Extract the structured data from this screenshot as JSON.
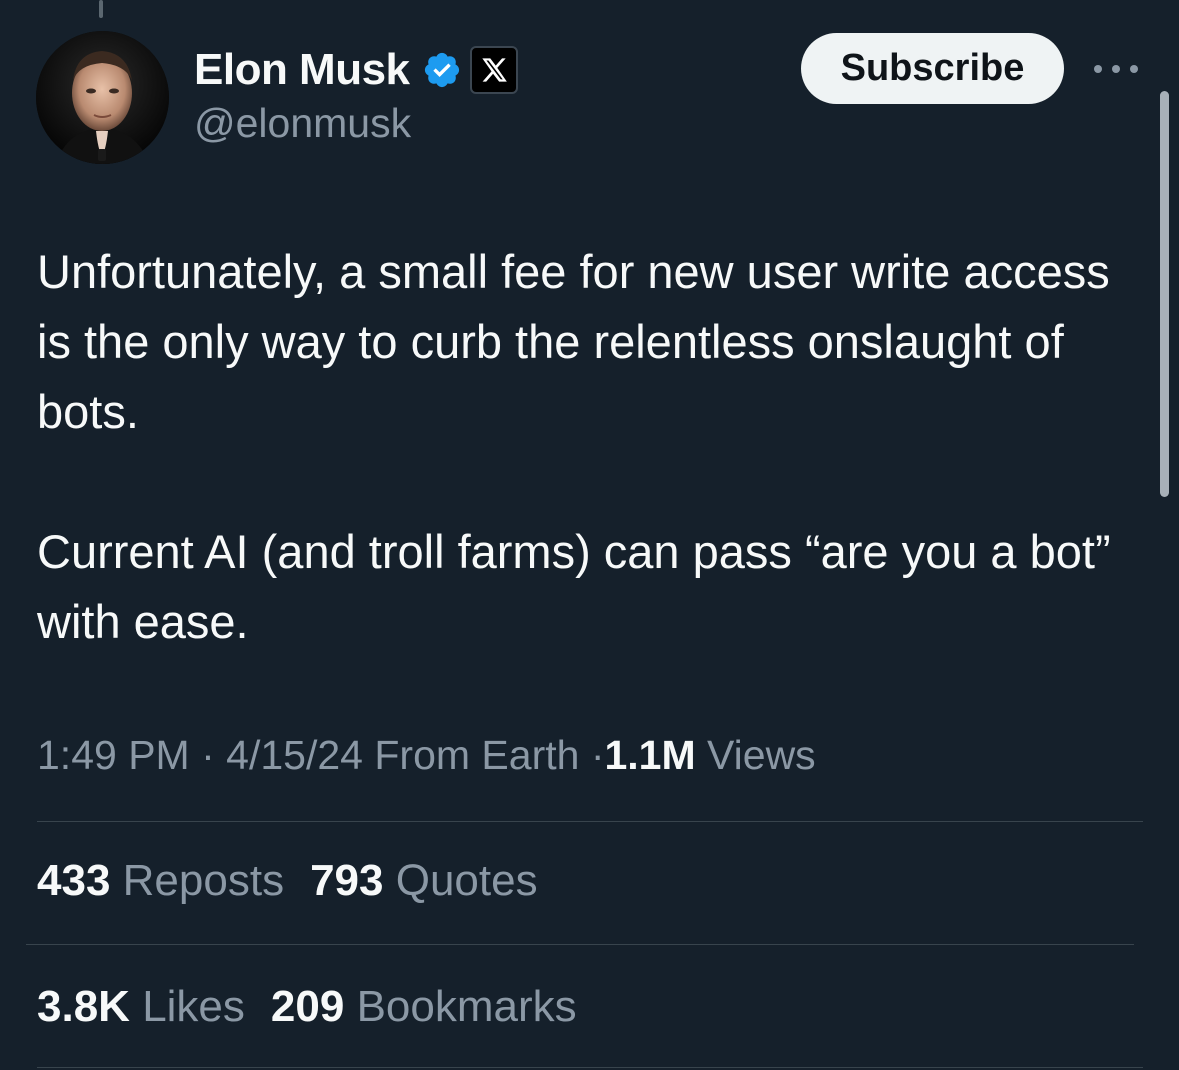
{
  "author": {
    "name": "Elon Musk",
    "handle": "@elonmusk",
    "verified_color": "#1d9bf0"
  },
  "actions": {
    "subscribe_label": "Subscribe",
    "more_icon": "more-horizontal-icon"
  },
  "tweet": {
    "paragraphs": [
      "Unfortunately, a small fee for new user write access is the only way to curb the relentless onslaught of bots.",
      "Current AI (and troll farms) can pass “are you a bot” with ease."
    ]
  },
  "meta": {
    "time": "1:49 PM",
    "separator": "·",
    "date": "4/15/24",
    "source": "From Earth",
    "views_count": "1.1M",
    "views_label": "Views"
  },
  "stats": {
    "reposts_count": "433",
    "reposts_label": "Reposts",
    "quotes_count": "793",
    "quotes_label": "Quotes",
    "likes_count": "3.8K",
    "likes_label": "Likes",
    "bookmarks_count": "209",
    "bookmarks_label": "Bookmarks"
  },
  "colors": {
    "background": "#15202b",
    "text": "#f7f9f9",
    "secondary": "#8b98a5",
    "divider": "#38444d"
  }
}
